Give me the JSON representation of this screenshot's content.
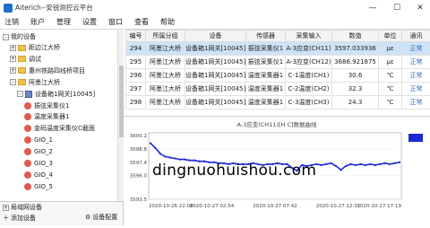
{
  "window": {
    "title": "Aiterich--安锐测控云平台"
  },
  "menu": [
    "注销",
    "账户",
    "管理",
    "设置",
    "窗口",
    "查看",
    "帮助"
  ],
  "sidebar": {
    "root": "我的设备",
    "items": [
      {
        "label": "距边江大桥",
        "kind": "folder",
        "level": 1,
        "toggle": "+"
      },
      {
        "label": "调试",
        "kind": "folder",
        "level": 1,
        "toggle": "+"
      },
      {
        "label": "惠州铁路四线桥项目",
        "kind": "folder",
        "level": 1,
        "toggle": "+"
      },
      {
        "label": "阿墨江大桥",
        "kind": "folder",
        "level": 1,
        "toggle": "-"
      },
      {
        "label": "设备箱1网关[10045]",
        "kind": "dev",
        "level": 2,
        "toggle": "-"
      },
      {
        "label": "振弦采集仪1",
        "kind": "sensor",
        "level": 3
      },
      {
        "label": "温度采集器1",
        "kind": "sensor",
        "level": 3
      },
      {
        "label": "金码温度采集仪C截面",
        "kind": "sensor",
        "level": 3
      },
      {
        "label": "GIO_1",
        "kind": "sensor",
        "level": 3
      },
      {
        "label": "GIO_2",
        "kind": "sensor",
        "level": 3
      },
      {
        "label": "GIO_3",
        "kind": "sensor",
        "level": 3
      },
      {
        "label": "GIO_4",
        "kind": "sensor",
        "level": 3
      },
      {
        "label": "GIO_5",
        "kind": "sensor",
        "level": 3
      }
    ],
    "bottom": [
      "局域网设备",
      "添加设备"
    ],
    "settings": "设备配置"
  },
  "table": {
    "headers": [
      "编号",
      "所属分组",
      "设备",
      "传感器",
      "采集输入",
      "数值",
      "单位",
      "通讯"
    ],
    "rows": [
      [
        "294",
        "阿墨江大桥",
        "设备箱1网关[10045]",
        "振弦采集仪1",
        "A-3应变(CH11)",
        "3597.033936",
        "με",
        "正常"
      ],
      [
        "295",
        "阿墨江大桥",
        "设备箱1网关[10045]",
        "振弦采集仪1",
        "A-3应变(CH12)",
        "3686.921875",
        "με",
        "正常"
      ],
      [
        "296",
        "阿墨江大桥",
        "设备箱1网关[10045]",
        "温度采集器1",
        "C-1温度(CH1)",
        "30.6",
        "℃",
        "正常"
      ],
      [
        "297",
        "阿墨江大桥",
        "设备箱1网关[10045]",
        "温度采集器1",
        "C-2温度(CH2)",
        "32.3",
        "℃",
        "正常"
      ],
      [
        "298",
        "阿墨江大桥",
        "设备箱1网关[10045]",
        "温度采集器1",
        "C-3温度(CH3)",
        "24.3",
        "℃",
        "正常"
      ]
    ],
    "selected_row": 0
  },
  "chart_data": {
    "type": "line",
    "title": "A-3应变(CH11)[H C]数据曲线",
    "ylim": [
      3593.5,
      3600.5
    ],
    "yticks": [
      "3600.2",
      "3598.8",
      "3597.4",
      "3596.0",
      "3593.5"
    ],
    "xticks": [
      "2020-10-26 22:06",
      "2020-10-27 02:54",
      "2020-10-27 07:42",
      "2020-10-27 12:31",
      "2020-10-27 17:19"
    ],
    "values": [
      3599.4,
      3598.9,
      3598.3,
      3598.0,
      3597.9,
      3597.8,
      3597.7,
      3597.7,
      3597.6,
      3597.6,
      3597.5,
      3597.5,
      3597.4,
      3597.4,
      3597.3,
      3597.3,
      3597.2,
      3597.3,
      3597.2,
      3597.2,
      3597.2,
      3597.3,
      3597.2,
      3597.1,
      3597.2,
      3597.2,
      3597.3,
      3597.2,
      3597.2,
      3596.8,
      3596.5,
      3597.1,
      3597.0,
      3597.1,
      3597.2,
      3597.1,
      3597.2,
      3597.3,
      3597.0,
      3596.6,
      3597.0,
      3597.2,
      3597.1,
      3597.2,
      3597.1,
      3597.2,
      3597.1,
      3597.2,
      3597.3,
      3597.2,
      3597.3,
      3597.4
    ],
    "line_color": "#1c28d6"
  },
  "watermark": "dingnuohuishou.com"
}
